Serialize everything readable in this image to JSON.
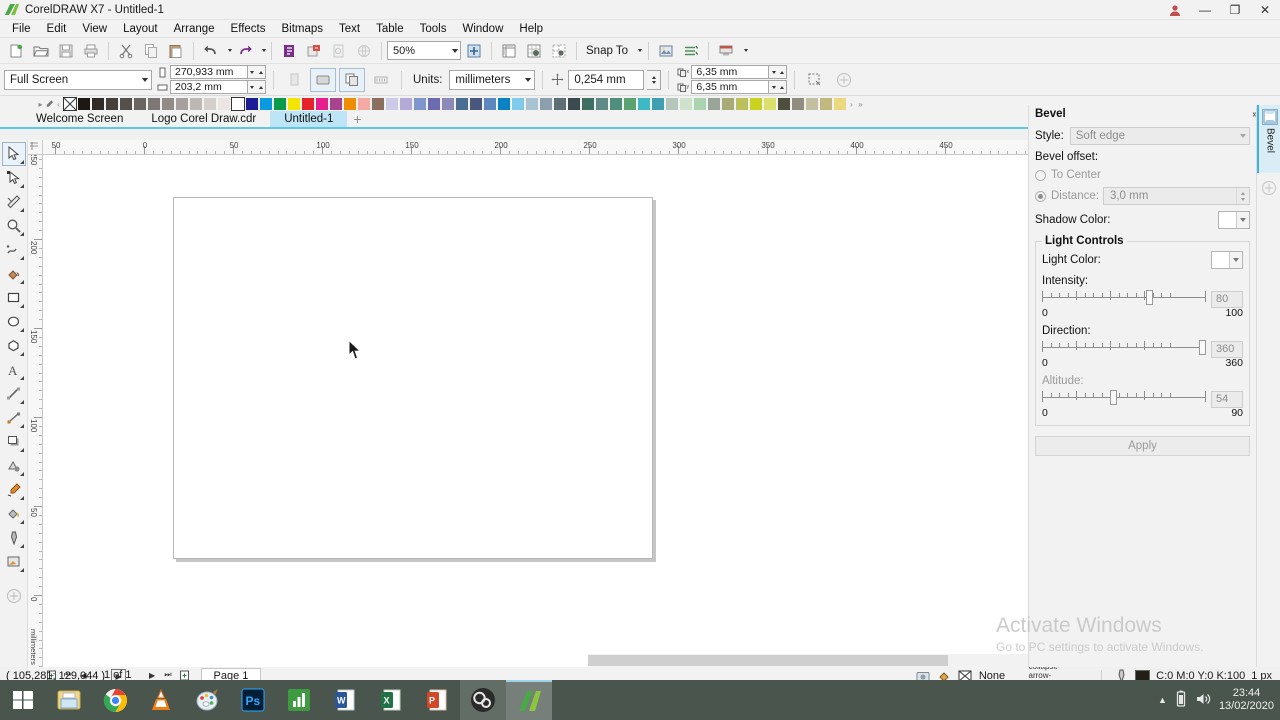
{
  "window": {
    "title": "CorelDRAW X7 - Untitled-1",
    "logo_icon": "coreldraw-logo",
    "minimize_label": "—",
    "maximize_label": "❐",
    "close_label": "✕",
    "user_icon": "user-account-icon"
  },
  "menu": {
    "items": [
      {
        "label": "File"
      },
      {
        "label": "Edit"
      },
      {
        "label": "View"
      },
      {
        "label": "Layout"
      },
      {
        "label": "Arrange"
      },
      {
        "label": "Effects"
      },
      {
        "label": "Bitmaps"
      },
      {
        "label": "Text"
      },
      {
        "label": "Table"
      },
      {
        "label": "Tools"
      },
      {
        "label": "Window"
      },
      {
        "label": "Help"
      }
    ]
  },
  "toolbar": {
    "buttons": [
      {
        "name": "new-document-icon",
        "title": "New"
      },
      {
        "name": "open-folder-icon",
        "title": "Open"
      },
      {
        "name": "save-icon",
        "title": "Save"
      },
      {
        "name": "print-icon",
        "title": "Print"
      },
      {
        "name": "cut-scissors-icon",
        "title": "Cut"
      },
      {
        "name": "copy-icon",
        "title": "Copy"
      },
      {
        "name": "paste-icon",
        "title": "Paste"
      },
      {
        "name": "undo-icon",
        "title": "Undo"
      },
      {
        "name": "redo-icon",
        "title": "Redo"
      },
      {
        "name": "import-icon",
        "title": "Import"
      },
      {
        "name": "export-icon",
        "title": "Export"
      },
      {
        "name": "publish-pdf-icon",
        "title": "Publish to PDF"
      }
    ],
    "zoom_level": "50%",
    "zoom_levels_icon": "zoom-levels-icon",
    "show_rulers_icon": "show-rulers-icon",
    "show_grid_icon": "show-grid-icon",
    "show_guidelines_icon": "show-guidelines-icon",
    "snap_to_label": "Snap To",
    "options_icon": "options-icon",
    "object_manager_icon": "object-manager-icon",
    "application_launcher_icon": "application-launcher-icon"
  },
  "propertybar": {
    "page_size": "Full Screen",
    "page_width": "270,933 mm",
    "page_height": "203,2 mm",
    "width_icon": "page-width-icon",
    "height_icon": "page-height-icon",
    "portrait_icon": "portrait-orientation-icon",
    "landscape_icon": "landscape-orientation-icon",
    "all_pages_icon": "apply-to-all-pages-icon",
    "current_page_icon": "apply-to-current-page-icon",
    "units_label": "Units:",
    "units_value": "millimeters",
    "nudge_icon": "nudge-offset-icon",
    "nudge_value": "0,254 mm",
    "duplicate_x_icon": "duplicate-distance-x-icon",
    "duplicate_y_icon": "duplicate-distance-y-icon",
    "duplicate_x": "6,35 mm",
    "duplicate_y": "6,35 mm",
    "treat_as_filled_icon": "treat-as-filled-icon",
    "add_icon": "add-icon"
  },
  "palette": {
    "nav_left": "‹",
    "nav_right": "›",
    "nav_more": "»",
    "none_label": "No color",
    "colors": [
      "#ffffff",
      "#1c1713",
      "#302b27",
      "#45403c",
      "#55504c",
      "#6a6561",
      "#7d7875",
      "#918c89",
      "#a6a19e",
      "#bdb8b5",
      "#d4cfcc",
      "#ebe6e3",
      "#ffffff",
      "#1d1d96",
      "#0a9ae0",
      "#0a9b4a",
      "#f2e600",
      "#e5232a",
      "#e51f8e",
      "#a8448f",
      "#ef8d00",
      "#f4a9a3",
      "#8b6f5e",
      "#cdc9e8",
      "#b3aad8",
      "#7f96cc",
      "#6c6ab0",
      "#8b8ab8",
      "#4a6d92",
      "#49577d",
      "#5d87c0",
      "#0c82c6",
      "#7fcbee",
      "#a8c3d4",
      "#8aa0ad",
      "#5d6f74",
      "#3a4a4e",
      "#3f6f63",
      "#5f8a85",
      "#4f8d7c",
      "#5ba471",
      "#3eb8c4",
      "#3e9fb0",
      "#b5c7bd",
      "#cfe2cd",
      "#a9d4ae",
      "#9aa59a",
      "#a9ab76",
      "#bcc05a",
      "#c8d21f",
      "#dbe06b",
      "#4e4f3f",
      "#8f8d7d",
      "#c3bfa2",
      "#c2b97f",
      "#ead97e"
    ]
  },
  "doctabs": {
    "tabs": [
      {
        "label": "Welcome Screen",
        "active": false
      },
      {
        "label": "Logo Corel Draw.cdr",
        "active": false
      },
      {
        "label": "Untitled-1",
        "active": true
      }
    ],
    "add_label": "+"
  },
  "toolbox": {
    "tools": [
      {
        "name": "pick-tool",
        "icon": "arrow-cursor-icon",
        "active": true
      },
      {
        "name": "shape-tool",
        "icon": "node-edit-icon",
        "active": false
      },
      {
        "name": "crop-tool",
        "icon": "crop-knife-icon",
        "active": false
      },
      {
        "name": "zoom-tool",
        "icon": "magnifier-icon",
        "active": false
      },
      {
        "name": "freehand-tool",
        "icon": "freehand-curve-icon",
        "active": false
      },
      {
        "name": "smart-fill-tool",
        "icon": "smart-fill-icon",
        "active": false
      },
      {
        "name": "rectangle-tool",
        "icon": "rectangle-icon",
        "active": false
      },
      {
        "name": "ellipse-tool",
        "icon": "ellipse-icon",
        "active": false
      },
      {
        "name": "polygon-tool",
        "icon": "polygon-icon",
        "active": false
      },
      {
        "name": "text-tool",
        "icon": "text-a-icon",
        "active": false
      },
      {
        "name": "parallel-dimension-tool",
        "icon": "dimension-line-icon",
        "active": false
      },
      {
        "name": "straight-line-connector-tool",
        "icon": "connector-icon",
        "active": false
      },
      {
        "name": "drop-shadow-tool",
        "icon": "drop-shadow-icon",
        "active": false
      },
      {
        "name": "transparency-tool",
        "icon": "transparency-icon",
        "active": false
      },
      {
        "name": "color-eyedropper-tool",
        "icon": "eyedropper-icon",
        "active": false
      },
      {
        "name": "interactive-fill-tool",
        "icon": "paint-bucket-icon",
        "active": false
      },
      {
        "name": "outline-tool",
        "icon": "outline-pen-icon",
        "active": false
      },
      {
        "name": "fill-tool",
        "icon": "fill-dialog-icon",
        "active": false
      },
      {
        "name": "quick-customize",
        "icon": "add-plus-circle-icon",
        "active": false
      }
    ]
  },
  "ruler": {
    "unit_label": "millimeters",
    "h_labels": [
      "50",
      "0",
      "50",
      "100",
      "150",
      "200",
      "250",
      "300",
      "350",
      "400",
      "450"
    ],
    "v_labels": [
      "50",
      "100",
      "150",
      "200",
      "250",
      "0"
    ],
    "origin_icon": "ruler-origin-icon"
  },
  "pagenav": {
    "add_page_start_icon": "add-page-before-icon",
    "first_icon": "first-page-icon",
    "prev_icon": "previous-page-icon",
    "count_label": "1 of 1",
    "next_icon": "next-page-icon",
    "last_icon": "last-page-icon",
    "add_page_end_icon": "add-page-after-icon",
    "page_tab": "Page 1",
    "collapse_icon": "collapse-arrow-icon"
  },
  "statusbar": {
    "coordinates": "( 105,281; 129,044 )",
    "expand_icon": "expand-status-icon",
    "fill_icon": "fill-swatch-icon",
    "fill_value": "None",
    "fill_none_icon": "no-fill-x-icon",
    "outline_icon": "outline-pen-icon",
    "outline_color_hex": "#231f18",
    "outline_value": "C:0 M:0 Y:0 K:100",
    "outline_width": "1 px",
    "snapshot_icon": "snapshot-icon"
  },
  "status_palette": {
    "nav_icon": "palette-arrow-icon",
    "pick_icon": "eyedropper-small-icon",
    "colors": [
      "#ffffff",
      "#6d6d6d",
      "#1a9ed9",
      "#ffffff"
    ]
  },
  "docker": {
    "title": "Bevel",
    "collapse_icon": "collapse-docker-icon",
    "close_icon": "close-docker-icon",
    "style_label": "Style:",
    "style_value": "Soft edge",
    "bevel_offset_label": "Bevel offset:",
    "to_center_label": "To Center",
    "distance_label": "Distance:",
    "distance_value": "3,0 mm",
    "shadow_color_label": "Shadow Color:",
    "shadow_color_hex": "#ffffff",
    "light_controls_label": "Light Controls",
    "light_color_label": "Light Color:",
    "light_color_hex": "#ffffff",
    "intensity_label": "Intensity:",
    "intensity_value": "80",
    "intensity_min": "0",
    "intensity_max": "100",
    "direction_label": "Direction:",
    "direction_value": "360",
    "direction_min": "0",
    "direction_max": "360",
    "altitude_label": "Altitude:",
    "altitude_value": "54",
    "altitude_min": "0",
    "altitude_max": "90",
    "apply_label": "Apply",
    "rail_tab_label": "Bevel",
    "rail_tab_icon": "bevel-docker-icon",
    "rail_add_icon": "add-docker-icon"
  },
  "watermark": {
    "line1": "Activate Windows",
    "line2": "Go to PC settings to activate Windows."
  },
  "taskbar": {
    "start_icon": "windows-start-icon",
    "items": [
      {
        "name": "file-explorer-icon",
        "label": "File Explorer",
        "running": false
      },
      {
        "name": "google-chrome-icon",
        "label": "Google Chrome",
        "running": false
      },
      {
        "name": "vlc-media-player-icon",
        "label": "VLC Media Player",
        "running": false
      },
      {
        "name": "paint-icon",
        "label": "Paint",
        "running": false
      },
      {
        "name": "photoshop-icon",
        "label": "Adobe Photoshop",
        "running": false
      },
      {
        "name": "chart-app-icon",
        "label": "Charts",
        "running": false
      },
      {
        "name": "word-icon",
        "label": "Microsoft Word",
        "running": false
      },
      {
        "name": "excel-icon",
        "label": "Microsoft Excel",
        "running": false
      },
      {
        "name": "powerpoint-icon",
        "label": "Microsoft PowerPoint",
        "running": false
      },
      {
        "name": "obs-studio-icon",
        "label": "OBS Studio",
        "running": true
      },
      {
        "name": "coreldraw-icon",
        "label": "CorelDRAW X7",
        "running": true,
        "active": true
      }
    ],
    "tray": {
      "show_hidden_icon": "show-hidden-icons-chevron",
      "battery_icon": "battery-icon",
      "volume_icon": "volume-icon",
      "time": "23:44",
      "date": "13/02/2020"
    }
  }
}
